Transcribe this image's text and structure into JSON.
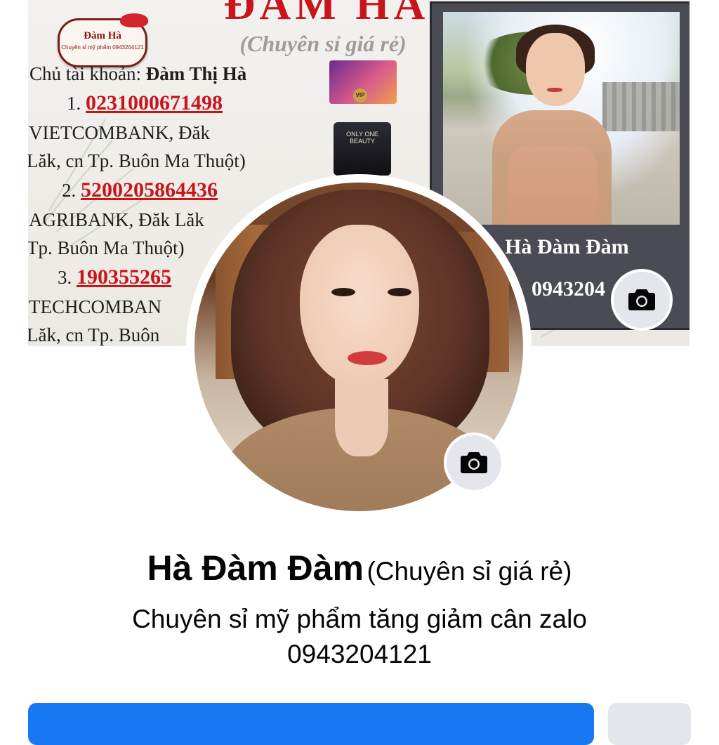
{
  "cover": {
    "brand": "ĐÀM HÀ",
    "tagline": "(Chuyên sỉ giá rẻ)",
    "logo_title": "Đàm Hà",
    "logo_sub": "Chuyên sỉ mỹ phẩm 0943204121",
    "owner_label": "Chủ tài khoản: ",
    "owner_name": "Đàm Thị Hà",
    "accounts": [
      {
        "num": "1.",
        "account": "0231000671498",
        "bank_line1": "(VIETCOMBANK, Đăk",
        "bank_line2": "Lăk, cn Tp. Buôn Ma Thuột)"
      },
      {
        "num": "2.",
        "account": "5200205864436",
        "bank_line1": "(AGRIBANK, Đăk Lăk",
        "bank_line2": "Tp. Buôn Ma Thuột)"
      },
      {
        "num": "3.",
        "account": "190355265",
        "bank_line1": "(TECHCOMBAN",
        "bank_line2": "Lăk, cn Tp. Buôn"
      }
    ],
    "product_top": "VIP",
    "product_label": "ONLY ONE BEAUTY",
    "frame_name": "Hà Đàm Đàm",
    "frame_phone": "0943204"
  },
  "profile": {
    "name": "Hà Đàm Đàm",
    "name_suffix": "(Chuyên sỉ giá rẻ)",
    "bio": "Chuyên sỉ mỹ phẩm tăng giảm cân zalo 0943204121"
  },
  "icons": {
    "cover_camera": "camera-icon",
    "profile_camera": "camera-icon"
  },
  "colors": {
    "primary": "#1877f2",
    "secondary": "#e4e6eb",
    "brand_red": "#c8141b"
  }
}
